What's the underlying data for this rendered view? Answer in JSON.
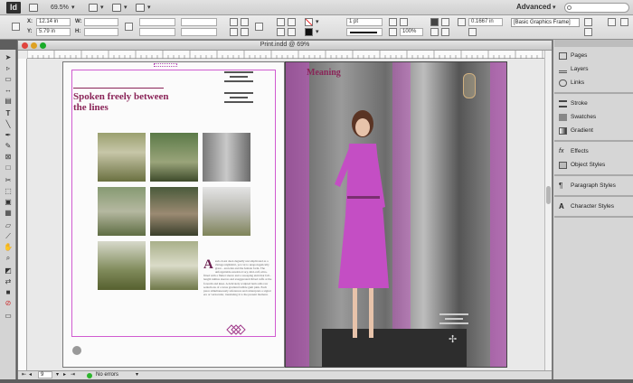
{
  "app": {
    "logo": "Id",
    "zoom": "69.5%",
    "workspace": "Advanced",
    "search_placeholder": ""
  },
  "control": {
    "x_label": "X:",
    "x_value": "12.14 in",
    "y_label": "Y:",
    "y_value": "5.79 in",
    "w_label": "W:",
    "h_label": "H:",
    "stroke_weight": "1 pt",
    "opacity": "100%",
    "offset": "0.1667 in",
    "object_style": "[Basic Graphics Frame]"
  },
  "document": {
    "title": "Print.indd @ 69%",
    "page_number": "9",
    "errors": "No errors"
  },
  "spread": {
    "left_headline": "Spoken freely between the lines",
    "right_title": "Meaning",
    "dropcap": "A",
    "body_text": "ssdo dosst deen degnelly uncomplicated as a vintage nightshirt, yet cut to unapologetically grace - and elan and the female form. The unforgettable zenobia ivory, mid-calf, ultra-fitted with a flutter sleeve and a sweeping skirt that fall - length tulmus sleeves and exaggerated ribbed cuffs at the forearm and knee. A delicately sculpted hem adds raw seductions of a lotus gradient bubble gum pink. Each piece simultaneously references and reinterprets a signal era or vernacular, translating it to the present moment."
  },
  "panels": {
    "pages": "Pages",
    "layers": "Layers",
    "links": "Links",
    "stroke": "Stroke",
    "swatches": "Swatches",
    "gradient": "Gradient",
    "effects": "Effects",
    "object_styles": "Object Styles",
    "paragraph_styles": "Paragraph Styles",
    "character_styles": "Character Styles"
  },
  "colors": {
    "accent": "#8a2458",
    "guides": "#d05bd0",
    "dress": "#c44ec4"
  }
}
